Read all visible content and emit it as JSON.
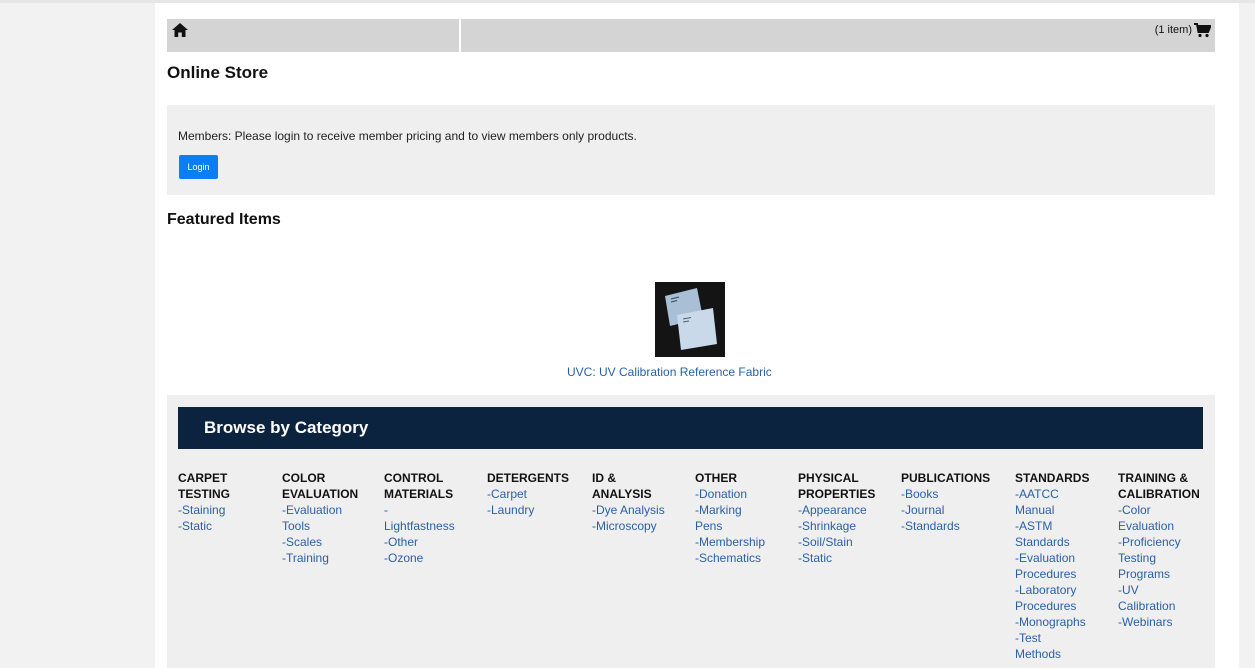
{
  "topbar": {
    "cart_label": "(1 item)"
  },
  "icons": {
    "home": "home-icon",
    "cart": "shopping-cart-icon"
  },
  "page_title": "Online Store",
  "notice": {
    "text": "Members: Please login to receive member pricing and to view members only products.",
    "login_label": "Login"
  },
  "featured": {
    "title": "Featured Items",
    "product_name": "UVC: UV Calibration Reference Fabric"
  },
  "browse": {
    "title": "Browse by Category",
    "categories": [
      {
        "heading": [
          "CARPET",
          "TESTING"
        ],
        "links": [
          "-Staining",
          "-Static"
        ]
      },
      {
        "heading": [
          "COLOR",
          "EVALUATION"
        ],
        "links": [
          "-Evaluation",
          "Tools",
          "-Scales",
          "-Training"
        ]
      },
      {
        "heading": [
          "CONTROL",
          "MATERIALS"
        ],
        "links": [
          "-",
          "Lightfastness",
          "-Other",
          "-Ozone"
        ]
      },
      {
        "heading": [
          "DETERGENTS"
        ],
        "links": [
          "-Carpet",
          "-Laundry"
        ]
      },
      {
        "heading": [
          "ID &",
          "ANALYSIS"
        ],
        "links": [
          "-Dye Analysis",
          "-Microscopy"
        ]
      },
      {
        "heading": [
          "OTHER"
        ],
        "links": [
          "-Donation",
          "-Marking",
          "Pens",
          "-Membership",
          "-Schematics"
        ]
      },
      {
        "heading": [
          "PHYSICAL",
          "PROPERTIES"
        ],
        "links": [
          "-Appearance",
          "-Shrinkage",
          "-Soil/Stain",
          "-Static"
        ]
      },
      {
        "heading": [
          "PUBLICATIONS"
        ],
        "links": [
          "-Books",
          "-Journal",
          "-Standards"
        ]
      },
      {
        "heading": [
          "STANDARDS"
        ],
        "links": [
          "-AATCC",
          "Manual",
          "-ASTM",
          "Standards",
          "-Evaluation",
          "Procedures",
          "-Laboratory",
          "Procedures",
          "-Monographs",
          "-Test",
          "Methods"
        ]
      },
      {
        "heading": [
          "TRAINING &",
          "CALIBRATION"
        ],
        "links": [
          "-Color",
          "Evaluation",
          "-Proficiency",
          "Testing",
          "Programs",
          "-UV",
          "Calibration",
          "-Webinars"
        ]
      }
    ]
  },
  "colors": {
    "link": "#2a5fa8",
    "button": "#0b7ef5",
    "browse_header": "#0c2340",
    "topbar": "#d4d4d4",
    "panel": "#efefef"
  }
}
